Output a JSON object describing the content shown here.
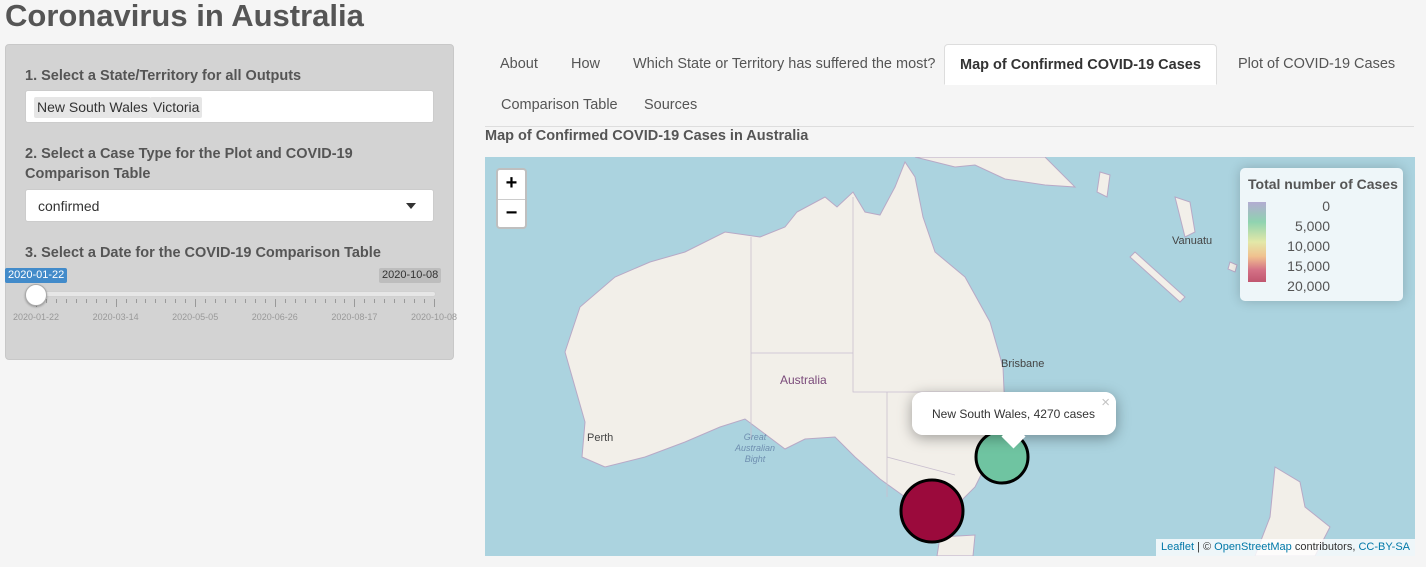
{
  "app": {
    "title": "Coronavirus in Australia"
  },
  "sidebar": {
    "state_label": "1. Select a State/Territory for all Outputs",
    "selected_states": [
      "New South Wales",
      "Victoria"
    ],
    "case_type_label": "2. Select a Case Type for the Plot and COVID-19 Comparison Table",
    "case_type_value": "confirmed",
    "date_label": "3. Select a Date for the COVID-19 Comparison Table",
    "slider": {
      "min": "2020-01-22",
      "max": "2020-10-08",
      "value": "2020-01-22",
      "value_fraction": 0.0,
      "tick_labels": [
        "2020-01-22",
        "2020-03-14",
        "2020-05-05",
        "2020-06-26",
        "2020-08-17",
        "2020-10-08"
      ]
    }
  },
  "tabs": [
    {
      "label": "About"
    },
    {
      "label": "How"
    },
    {
      "label": "Which State or Territory has suffered the most?"
    },
    {
      "label": "Map of Confirmed COVID-19 Cases",
      "active": true
    },
    {
      "label": "Plot of COVID-19 Cases"
    },
    {
      "label": "Comparison Table"
    },
    {
      "label": "Sources"
    }
  ],
  "map": {
    "heading": "Map of Confirmed COVID-19 Cases in Australia",
    "zoom_in": "+",
    "zoom_out": "−",
    "legend": {
      "title": "Total number of Cases",
      "labels": [
        "0",
        "5,000",
        "10,000",
        "15,000",
        "20,000"
      ]
    },
    "place_labels": {
      "australia": "Australia",
      "perth": "Perth",
      "brisbane": "Brisbane",
      "vanuatu": "Vanuatu",
      "bight": "Great Australian Bight"
    },
    "popup": {
      "text": "New South Wales, 4270 cases",
      "close": "×"
    },
    "markers": [
      {
        "name": "New South Wales",
        "cases": 4270,
        "color": "#6fc4a1"
      },
      {
        "name": "Victoria",
        "color": "#9b0a3c"
      }
    ],
    "attribution": {
      "leaflet": "Leaflet",
      "sep": " | © ",
      "osm": "OpenStreetMap",
      "contributors": " contributors, ",
      "license": "CC-BY-SA"
    }
  }
}
